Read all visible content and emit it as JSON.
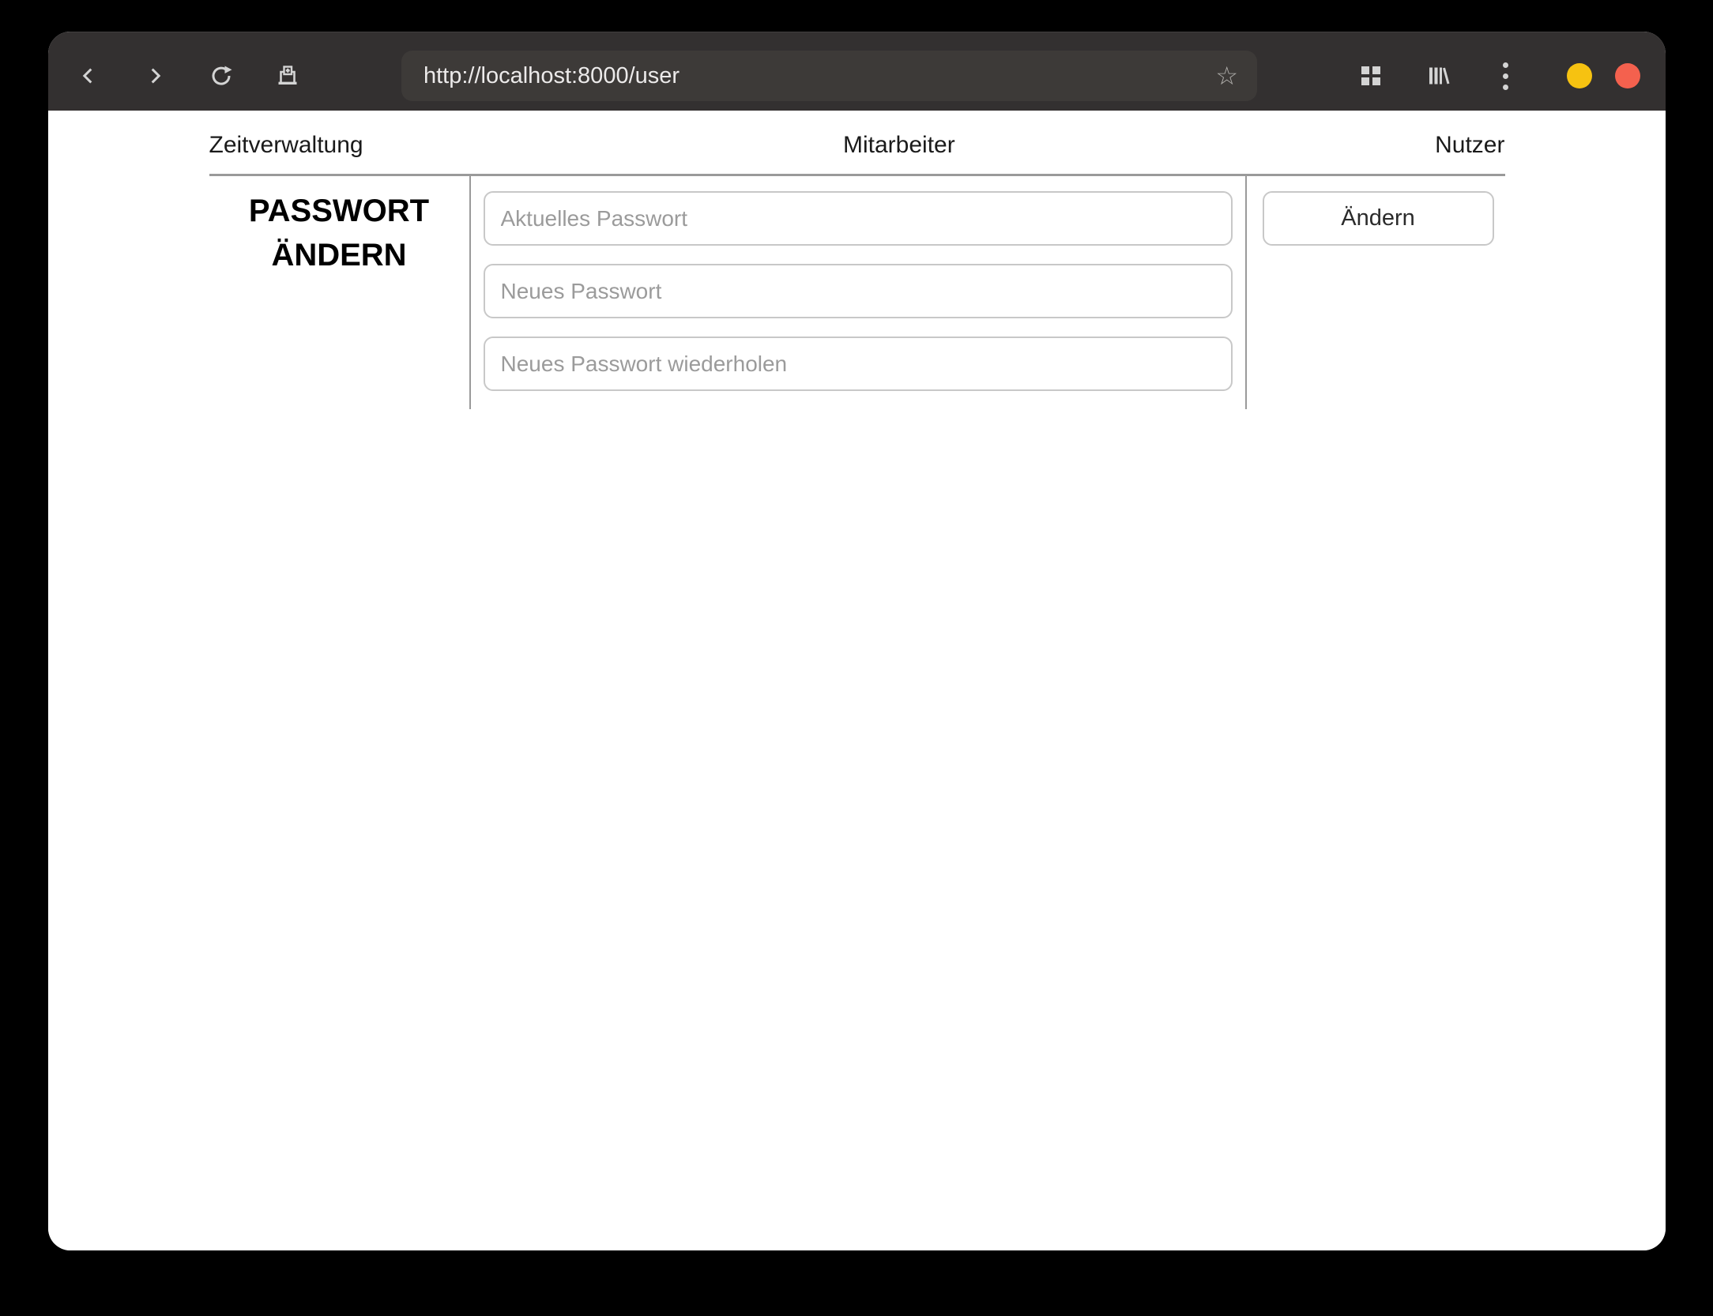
{
  "colors": {
    "outer_bg": "#000000",
    "titlebar_bg": "#333030",
    "urlbar_bg": "#3d3a38",
    "titlebar_icon": "#d4d4d4",
    "minimize_button": "#f6c211",
    "close_button": "#f4614e",
    "page_bg": "#ffffff",
    "rule": "#9a9a9a",
    "field_border": "#c8c8c8",
    "placeholder": "#9b9b9b",
    "text": "#1a1a1a"
  },
  "browser": {
    "url": "http://localhost:8000/user",
    "bookmark_star_glyph": "☆"
  },
  "nav": {
    "tabs": [
      {
        "label": "Zeitverwaltung"
      },
      {
        "label": "Mitarbeiter"
      },
      {
        "label": "Nutzer"
      }
    ]
  },
  "form": {
    "heading": "PASSWORT ÄNDERN",
    "fields": [
      {
        "placeholder": "Aktuelles Passwort"
      },
      {
        "placeholder": "Neues Passwort"
      },
      {
        "placeholder": "Neues Passwort wiederholen"
      }
    ],
    "submit_label": "Ändern"
  }
}
